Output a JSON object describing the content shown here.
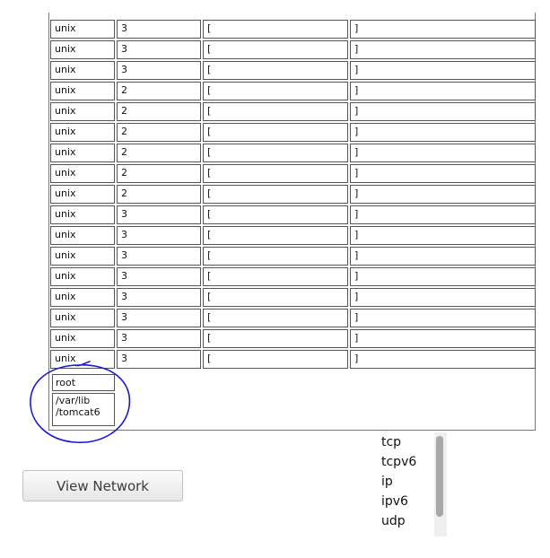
{
  "table": {
    "rows": [
      [
        "unix",
        "3",
        "[",
        "]"
      ],
      [
        "unix",
        "3",
        "[",
        "]"
      ],
      [
        "unix",
        "3",
        "[",
        "]"
      ],
      [
        "unix",
        "2",
        "[",
        "]"
      ],
      [
        "unix",
        "2",
        "[",
        "]"
      ],
      [
        "unix",
        "2",
        "[",
        "]"
      ],
      [
        "unix",
        "2",
        "[",
        "]"
      ],
      [
        "unix",
        "2",
        "[",
        "]"
      ],
      [
        "unix",
        "2",
        "[",
        "]"
      ],
      [
        "unix",
        "3",
        "[",
        "]"
      ],
      [
        "unix",
        "3",
        "[",
        "]"
      ],
      [
        "unix",
        "3",
        "[",
        "]"
      ],
      [
        "unix",
        "3",
        "[",
        "]"
      ],
      [
        "unix",
        "3",
        "[",
        "]"
      ],
      [
        "unix",
        "3",
        "[",
        "]"
      ],
      [
        "unix",
        "3",
        "[",
        "]"
      ],
      [
        "unix",
        "3",
        "[",
        "]"
      ]
    ],
    "user": "root",
    "home_dir": "/var/lib\n/tomcat6"
  },
  "annotation": {
    "color": "#1a1acc"
  },
  "view_network_label": "View Network",
  "protocols": [
    "tcp",
    "tcpv6",
    "ip",
    "ipv6",
    "udp"
  ]
}
